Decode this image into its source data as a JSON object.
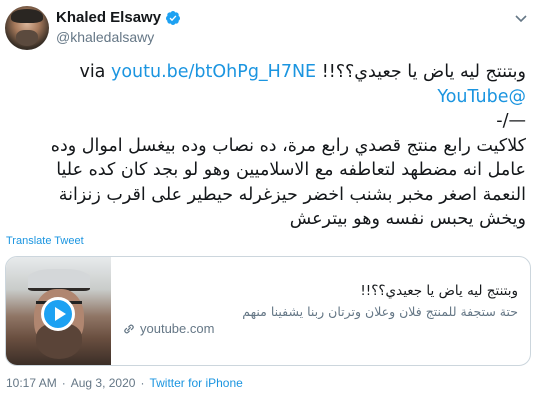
{
  "user": {
    "name": "Khaled Elsawy",
    "handle": "@khaledalsawy"
  },
  "tweet": {
    "line1_text": "وبتنتج ليه ياض يا جعيدي؟؟!! via ",
    "line1_link": "youtu.be/btOhPg_H7NE",
    "line2_link": "@YouTube",
    "line3": "—/-",
    "line4": "كلاكيت رابع منتج قصدي رابع مرة، ده نصاب وده بيغسل اموال وده",
    "line5": "عامل انه مضطهد لتعاطفه مع الاسلاميين وهو لو بجد كان كده عليا",
    "line6": "النعمة اصغر مخبر بشنب اخضر حيزغرله حيطير على اقرب زنزانة",
    "line7": "ويخش يحبس نفسه وهو بيترعش"
  },
  "translate_label": "Translate Tweet",
  "card": {
    "title": "وبتنتج ليه ياض يا جعيدي؟؟!!",
    "description": "حتة ستجفة للمنتج فلان وعلان وترتان ربنا يشفينا منهم",
    "domain": "youtube.com"
  },
  "meta": {
    "time": "10:17 AM",
    "separator": "·",
    "date": "Aug 3, 2020",
    "source": "Twitter for iPhone"
  },
  "colors": {
    "accent": "#1b95e0",
    "secondary_text": "#657786",
    "border": "#ccd6dd"
  }
}
